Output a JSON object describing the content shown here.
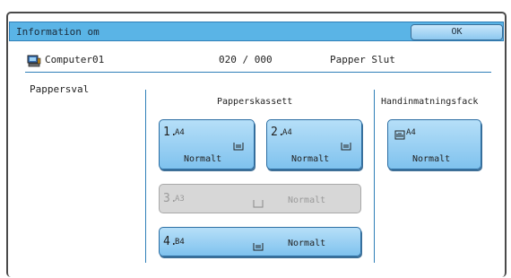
{
  "header": {
    "title": "Information om",
    "ok_label": "OK"
  },
  "info": {
    "computer": "Computer01",
    "counter": "020 / 000",
    "status": "Papper Slut"
  },
  "section_label": "Pappersval",
  "columns": {
    "cassette": "Papperskassett",
    "manual": "Handinmatningsfack"
  },
  "trays": [
    {
      "num": "1.",
      "size": "A4",
      "type": "Normalt",
      "enabled": true
    },
    {
      "num": "2.",
      "size": "A4",
      "type": "Normalt",
      "enabled": true
    },
    {
      "num": "3.",
      "size": "A3",
      "type": "Normalt",
      "enabled": false
    },
    {
      "num": "4.",
      "size": "B4",
      "type": "Normalt",
      "enabled": true
    }
  ],
  "manual_tray": {
    "size": "A4",
    "type": "Normalt"
  }
}
